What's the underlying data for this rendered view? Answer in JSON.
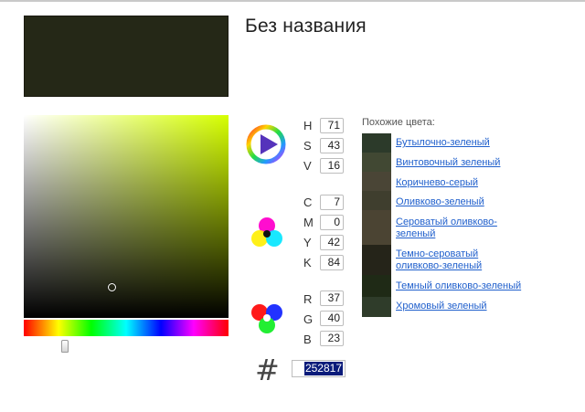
{
  "title": "Без названия",
  "preview_color": "#252817",
  "hsv": {
    "H": "71",
    "S": "43",
    "V": "16"
  },
  "cmyk": {
    "C": "7",
    "M": "0",
    "Y": "42",
    "K": "84"
  },
  "rgb": {
    "R": "37",
    "G": "40",
    "B": "23"
  },
  "hex": "252817",
  "labels": {
    "H": "H",
    "S": "S",
    "V": "V",
    "C": "C",
    "M": "M",
    "Y": "Y",
    "K": "K",
    "R": "R",
    "G": "G",
    "B": "B",
    "hash": "#"
  },
  "similar": {
    "title": "Похожие цвета:",
    "items": [
      {
        "name": "Бутылочно-зеленый",
        "color": "#2c3a2a"
      },
      {
        "name": "Винтовочный зеленый",
        "color": "#414833"
      },
      {
        "name": "Коричнево-серый",
        "color": "#4a4536"
      },
      {
        "name": "Оливково-зеленый",
        "color": "#3f3e2e"
      },
      {
        "name": "Сероватый оливково-зеленый",
        "color": "#4b4433"
      },
      {
        "name": "Темно-сероватый оливково-зеленый",
        "color": "#252419"
      },
      {
        "name": "Темный оливково-зеленый",
        "color": "#1f2a16"
      },
      {
        "name": "Хромовый зеленый",
        "color": "#2f3c2a"
      }
    ]
  },
  "icons": {
    "hsv": "hsv-wheel-play-icon",
    "cmyk": "cmyk-circles-icon",
    "rgb": "rgb-circles-icon"
  }
}
